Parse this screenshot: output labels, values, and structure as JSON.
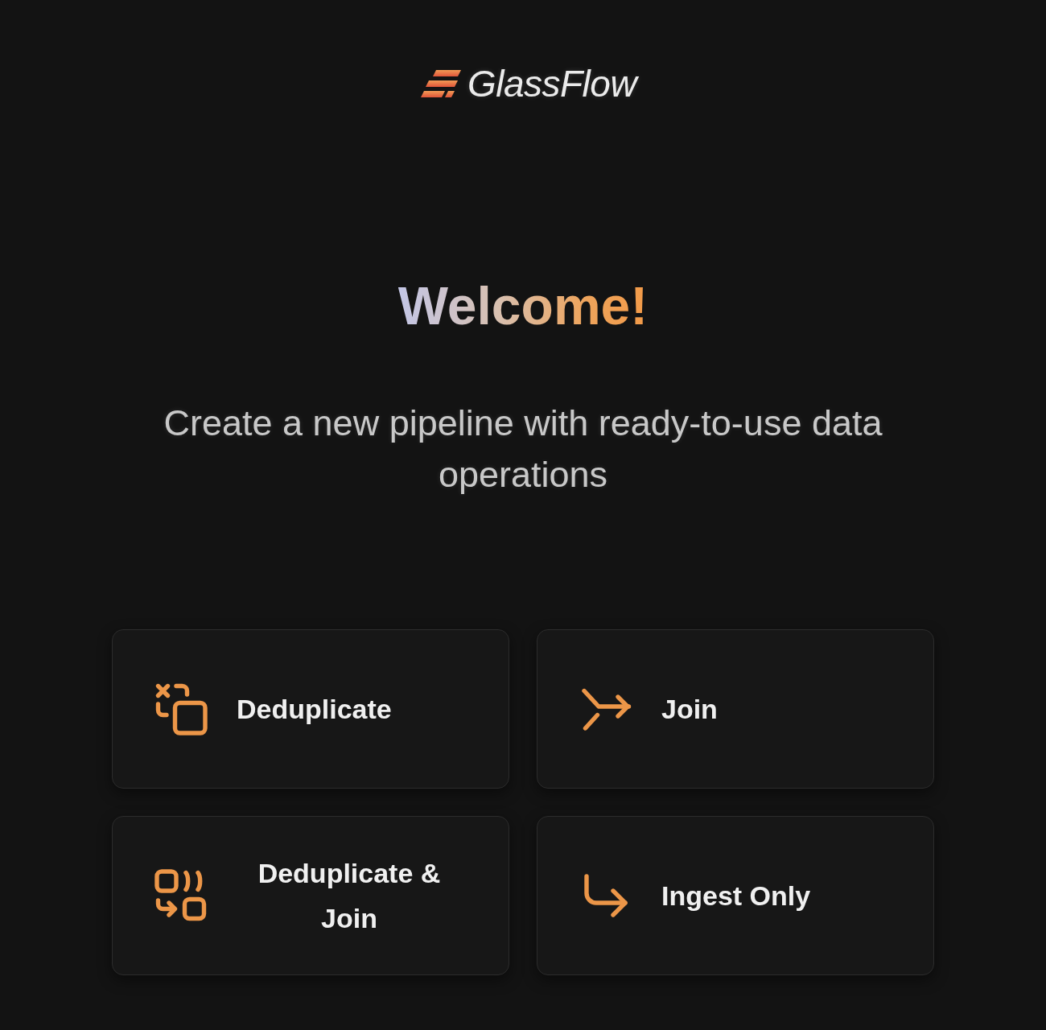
{
  "logo": {
    "text": "GlassFlow"
  },
  "heading": "Welcome!",
  "subtitle": "Create a new pipeline with ready-to-use data operations",
  "operations": [
    {
      "kind": "deduplicate",
      "label": "Deduplicate"
    },
    {
      "kind": "join",
      "label": "Join"
    },
    {
      "kind": "deduplicate-join",
      "label": "Deduplicate & Join"
    },
    {
      "kind": "ingest",
      "label": "Ingest Only"
    }
  ]
}
